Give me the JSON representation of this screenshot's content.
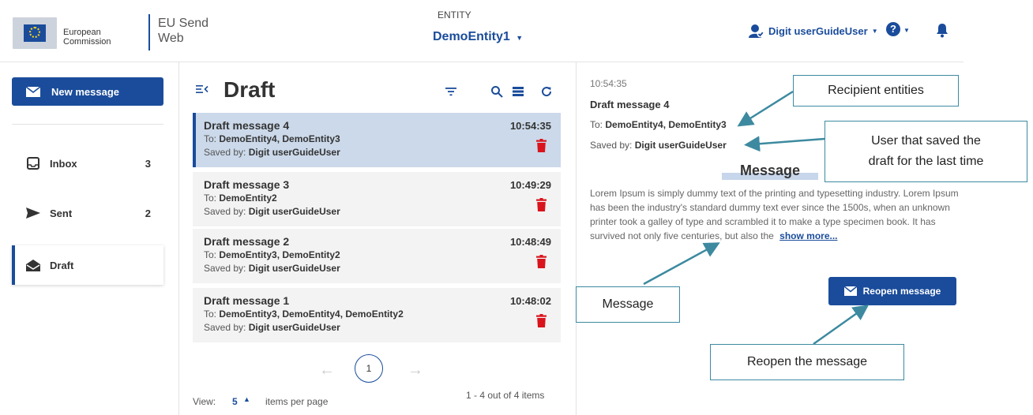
{
  "header": {
    "logo_line1": "European",
    "logo_line2": "Commission",
    "app_title_line1": "EU Send",
    "app_title_line2": "Web",
    "entity_label": "ENTITY",
    "entity_value": "DemoEntity1",
    "user_name": "Digit userGuideUser"
  },
  "sidebar": {
    "new_message": "New message",
    "items": [
      {
        "label": "Inbox",
        "count": "3"
      },
      {
        "label": "Sent",
        "count": "2"
      },
      {
        "label": "Draft",
        "count": ""
      }
    ]
  },
  "list": {
    "title": "Draft",
    "to_prefix": "To:",
    "saved_prefix": "Saved by:",
    "messages": [
      {
        "subject": "Draft message 4",
        "to": "DemoEntity4, DemoEntity3",
        "saved_by": "Digit userGuideUser",
        "time": "10:54:35"
      },
      {
        "subject": "Draft message 3",
        "to": "DemoEntity2",
        "saved_by": "Digit userGuideUser",
        "time": "10:49:29"
      },
      {
        "subject": "Draft message 2",
        "to": "DemoEntity3, DemoEntity2",
        "saved_by": "Digit userGuideUser",
        "time": "10:48:49"
      },
      {
        "subject": "Draft message 1",
        "to": "DemoEntity3, DemoEntity4, DemoEntity2",
        "saved_by": "Digit userGuideUser",
        "time": "10:48:02"
      }
    ],
    "pager": {
      "current_page": "1"
    },
    "view_label": "View:",
    "view_count": "5",
    "per_page_label": "items per page",
    "range_text": "1 - 4 out of 4 items"
  },
  "detail": {
    "time": "10:54:35",
    "subject": "Draft message 4",
    "to_prefix": "To:",
    "to": "DemoEntity4, DemoEntity3",
    "saved_prefix": "Saved by:",
    "saved_by": "Digit userGuideUser",
    "message_heading": "Message",
    "body": "Lorem Ipsum is simply dummy text of the printing and typesetting industry. Lorem Ipsum has been the industry's standard dummy text ever since the 1500s, when an unknown printer took a galley of type and scrambled it to make a type specimen book. It has survived not only five centuries, but also the",
    "show_more": "show more...",
    "reopen_button": "Reopen message"
  },
  "annotations": {
    "recipient_entities": "Recipient entities",
    "user_saved_line1": "User that saved the",
    "user_saved_line2": "draft for the last time",
    "message": "Message",
    "reopen": "Reopen the message"
  },
  "colors": {
    "brand": "#1a4c9b",
    "selected_row": "#cbd9ea",
    "delete": "#d9141c",
    "annotation": "#3d8aa0"
  }
}
